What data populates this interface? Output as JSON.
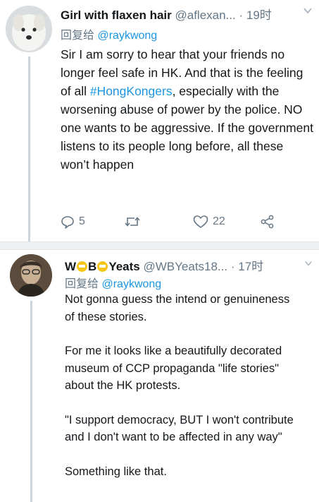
{
  "tweet1": {
    "name": "Girl with flaxen hair",
    "handle": "@aflexan...",
    "time": "· 19时",
    "reply_prefix": "回复给",
    "reply_to": "@raykwong",
    "text_before": "Sir I am sorry to hear that your friends no longer feel safe in HK. And that is the feeling of all ",
    "hashtag": "#HongKongers",
    "text_after": ", especially with the worsening abuse of power by the police. NO one wants to be aggressive. If the government listens to its people long before, all these won’t happen",
    "replies": "5",
    "likes": "22"
  },
  "tweet2": {
    "name_part1": "W",
    "name_part2": "B",
    "name_part3": "Yeats",
    "handle": "@WBYeats18...",
    "time": "· 17时",
    "reply_prefix": "回复给",
    "reply_to": "@raykwong",
    "paragraphs": [
      "Not gonna guess the intend or genuineness of these stories.",
      "For me it looks like a beautifully decorated museum of CCP propaganda \"life stories\" about the HK protests.",
      "\"I support democracy, BUT I won't contribute and I don't want to be affected in any way\"",
      "Something like that."
    ]
  },
  "icons": [
    "reply-icon",
    "retweet-icon",
    "like-icon",
    "share-icon",
    "chevron-down-icon"
  ],
  "colors": {
    "link": "#1b95e0",
    "muted": "#657786",
    "text": "#14171a"
  }
}
